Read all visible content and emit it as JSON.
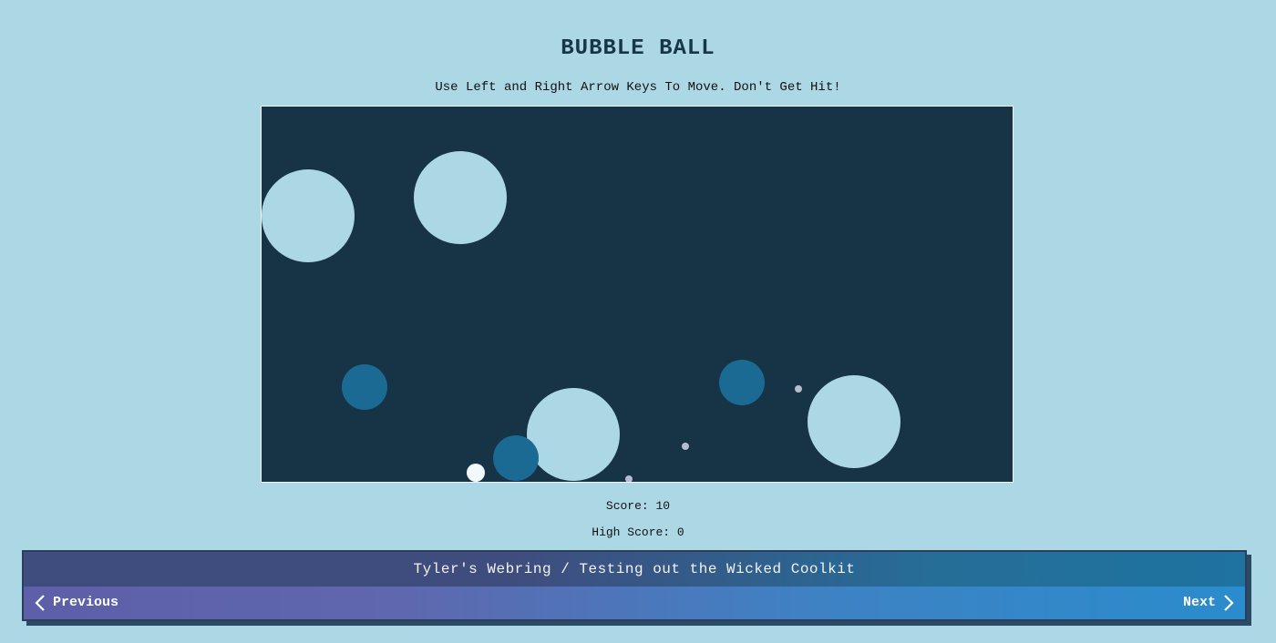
{
  "header": {
    "title": "BUBBLE BALL",
    "instructions": "Use Left and Right Arrow Keys To Move. Don't Get Hit!"
  },
  "colors": {
    "page_background": "#acd8e6",
    "board_background": "#163445",
    "big_bubble": "#acd8e6",
    "small_bubble": "#1a6a94",
    "player": "#f2f8fb",
    "pellet": "#b8bccf"
  },
  "game": {
    "big_bubbles": 4,
    "small_bubbles": 3,
    "pellets": 3
  },
  "stats": {
    "score_text": "Score: 10",
    "high_score_text": "High Score: 0"
  },
  "webring": {
    "title": "Tyler's Webring / Testing out the Wicked Coolkit",
    "prev_label": "Previous",
    "next_label": "Next",
    "prev_icon": "chevron-left-icon",
    "next_icon": "chevron-right-icon"
  }
}
